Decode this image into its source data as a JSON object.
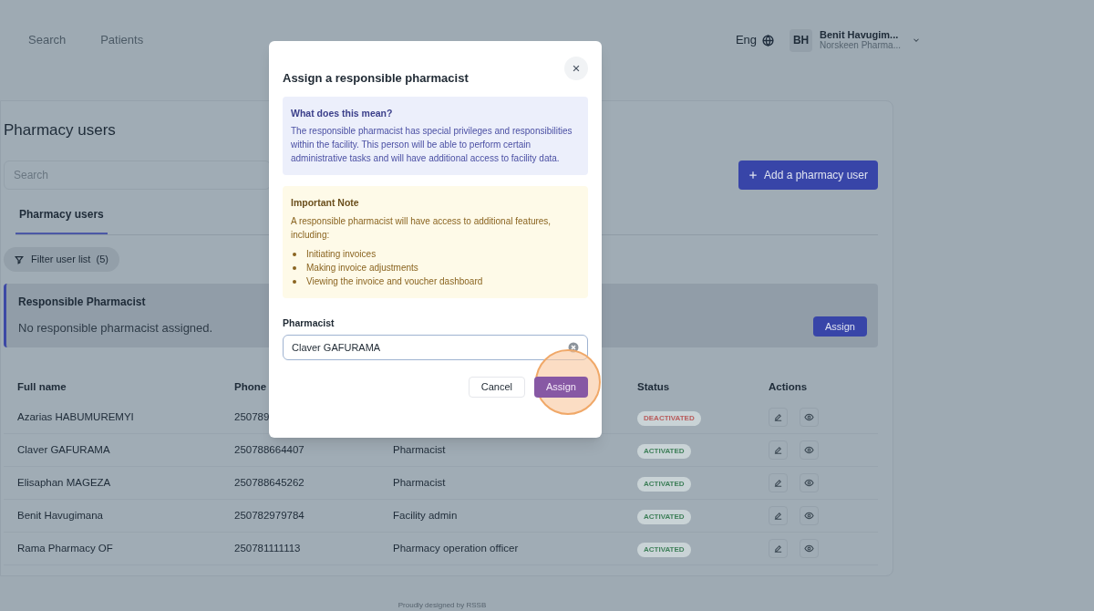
{
  "nav": {
    "links": [
      "Search",
      "Patients"
    ],
    "language": "Eng",
    "user": {
      "initials": "BH",
      "name": "Benit Havugim...",
      "org": "Norskeen Pharma..."
    }
  },
  "page": {
    "title": "Pharmacy users",
    "search": {
      "placeholder": "Search"
    },
    "add_button": "Add a pharmacy user",
    "tabs": [
      {
        "label": "Pharmacy users",
        "selected": true
      }
    ],
    "filter": "Filter user list  (5)",
    "banner": {
      "title": "Responsible Pharmacist",
      "text": "No responsible pharmacist assigned.",
      "button": "Assign"
    },
    "table": {
      "columns": [
        "Full name",
        "Phone",
        "Status",
        "Actions"
      ],
      "rows": [
        {
          "name": "Azarias HABUMUREMYI",
          "phone": "250789",
          "status": "DEACTIVATED",
          "color": "#b85a5a"
        },
        {
          "name": "Claver GAFURAMA",
          "phone": "250788664407",
          "role": "Pharmacist",
          "status": "ACTIVATED",
          "color": "#3d7f58"
        },
        {
          "name": "Elisaphan MAGEZA",
          "phone": "250788645262",
          "role": "Pharmacist",
          "status": "ACTIVATED",
          "color": "#3d7f58"
        },
        {
          "name": "Benit Havugimana",
          "phone": "250782979784",
          "role": "Facility admin",
          "status": "ACTIVATED",
          "color": "#3d7f58"
        },
        {
          "name": "Rama Pharmacy OF",
          "phone": "250781111113",
          "role": "Pharmacy operation officer",
          "status": "ACTIVATED",
          "color": "#3d7f58"
        }
      ]
    },
    "footer": "Proudly designed by RSSB"
  },
  "dialog": {
    "title": "Assign a responsible pharmacist",
    "info": {
      "title": "What does this mean?",
      "text": "The responsible pharmacist has special privileges and responsibilities within the facility. This person will be able to perform certain administrative tasks and will have additional access to facility data."
    },
    "note": {
      "title": "Important Note",
      "text": "A responsible pharmacist will have access to additional features, including:",
      "items": [
        "Initiating invoices",
        "Making invoice adjustments",
        "Viewing the invoice and voucher dashboard"
      ]
    },
    "field": {
      "label": "Pharmacist",
      "value": "Claver GAFURAMA"
    },
    "buttons": {
      "cancel": "Cancel",
      "assign": "Assign"
    }
  }
}
